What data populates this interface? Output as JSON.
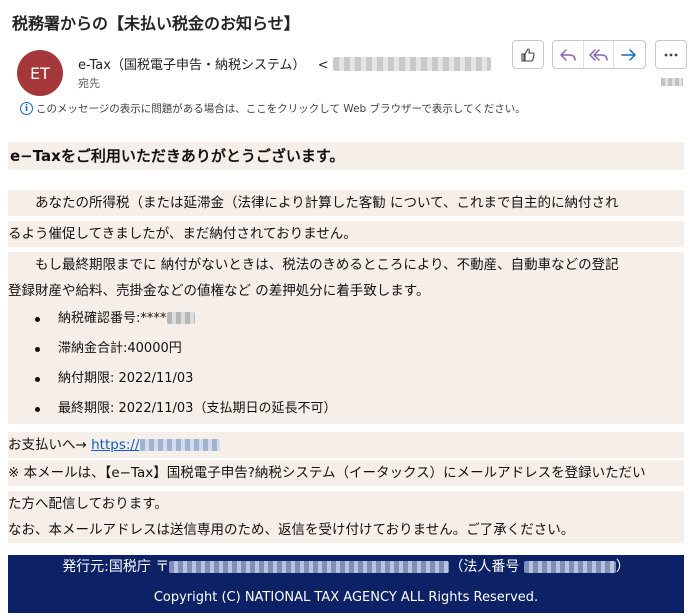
{
  "email": {
    "subject": "税務署からの【未払い税金のお知らせ】",
    "avatar_initials": "ET",
    "sender_name": "e-Tax（国税電子申告・納税システム）",
    "sender_email_open": "<",
    "recipient_label": "宛先",
    "info_bar": "このメッセージの表示に問題がある場合は、ここをクリックして Web ブラウザーで表示してください。"
  },
  "toolbar": {
    "like": "thumbs-up-icon",
    "reply": "reply-icon",
    "reply_all": "reply-all-icon",
    "forward": "forward-icon",
    "more": "more-icon",
    "accent": "#0f6cbd"
  },
  "body": {
    "greeting": "e−Taxをご利用いただきありがとうございます。",
    "para1_line1": "　　あなたの所得税（または延滞金（法律により計算した客勧 について、これまで自主的に納付され",
    "para1_line2": "るよう催促してきましたが、まだ納付されておりません。",
    "para2_line1": "　　もし最終期限までに 納付がないときは、税法のきめるところにより、不動産、自動車などの登記",
    "para2_line2": "登録財産や給料、売掛金などの値権など の差押処分に着手致します。",
    "items": {
      "confirm_no": "納税確認番号:****",
      "total": "滞納金合計:40000円",
      "due": "納付期限: 2022/11/03",
      "final_due": "最終期限: 2022/11/03（支払期日の延長不可）"
    },
    "payment_prefix": "お支払いへ→ ",
    "payment_link": "https://",
    "notice_line1": "※ 本メールは、【e−Tax】国税電子申告?納税システム（イータックス）にメールアドレスを登録いただい",
    "notice_line2": "た方へ配信しております。",
    "notice_line3": "なお、本メールアドレスは送信専用のため、返信を受け付けておりません。ご了承ください。"
  },
  "footer": {
    "issuer_prefix": "発行元:国税庁 〒",
    "corp_no_label": "（法人番号 ",
    "corp_no_close": "）",
    "copyright": "Copyright (C) NATIONAL TAX AGENCY ALL Rights Reserved.",
    "bg_color": "#0c2166"
  }
}
